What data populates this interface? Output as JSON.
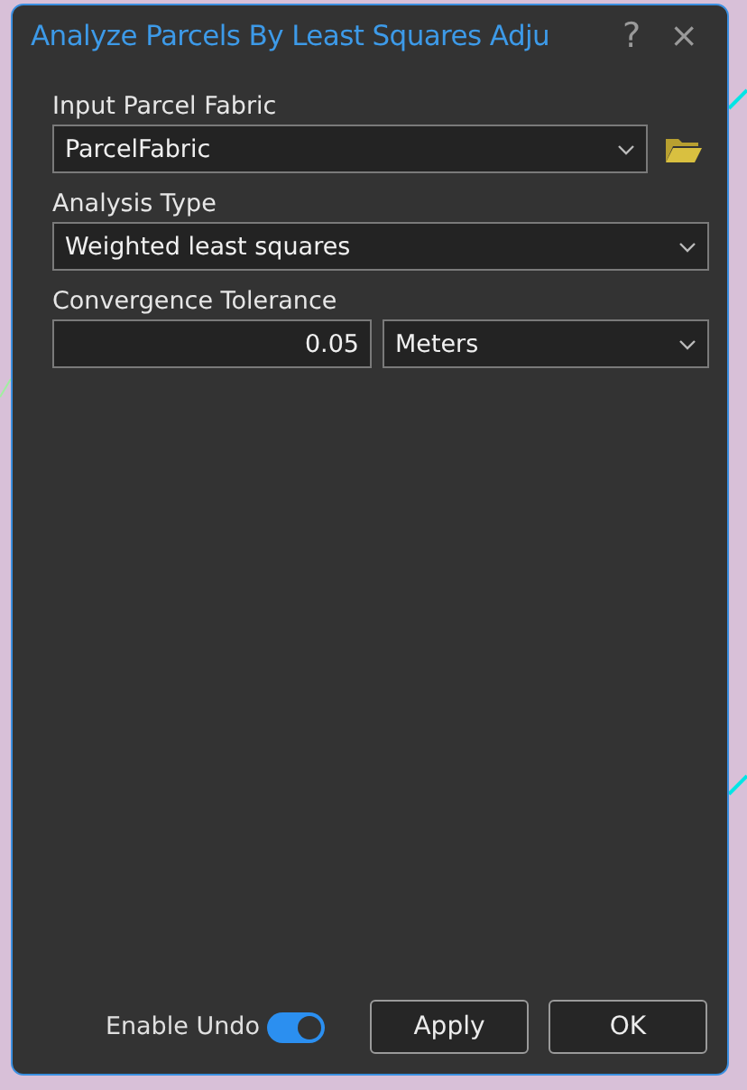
{
  "window": {
    "title": "Analyze Parcels By Least Squares Adju",
    "help": "?",
    "close": "×"
  },
  "fields": [
    {
      "kind": "browse-select",
      "label": "Input Parcel Fabric",
      "value": "ParcelFabric"
    },
    {
      "kind": "select",
      "label": "Analysis Type",
      "value": "Weighted least squares"
    },
    {
      "kind": "number-unit",
      "label": "Convergence Tolerance",
      "value": "0.05",
      "unit": "Meters"
    }
  ],
  "footer": {
    "toggle": {
      "label": "Enable Undo",
      "on": true
    },
    "buttons": [
      "Apply",
      "OK"
    ]
  }
}
